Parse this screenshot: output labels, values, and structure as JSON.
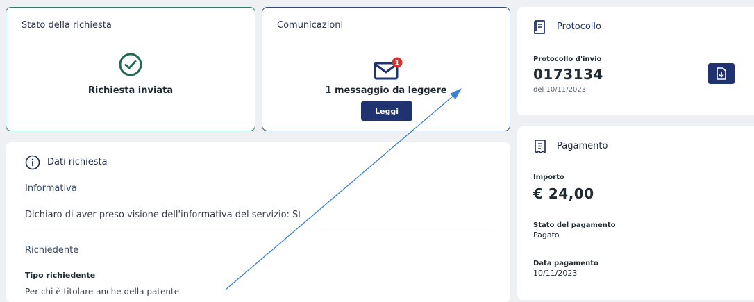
{
  "status": {
    "title": "Stato della richiesta",
    "icon": "check-circle-icon",
    "text": "Richiesta inviata",
    "color": "#1f6b52"
  },
  "communications": {
    "title": "Comunicazioni",
    "icon": "mail-icon",
    "badge": "1",
    "message": "1 messaggio da leggere",
    "button": "Leggi",
    "badge_color": "#d6322a"
  },
  "request_data": {
    "title": "Dati richiesta",
    "icon": "info-icon",
    "sections": [
      {
        "label": "Informativa",
        "text": "Dichiaro di aver preso visione dell'informativa del servizio: Sì"
      },
      {
        "label": "Richiedente",
        "field_label": "Tipo richiedente",
        "field_value": "Per chi è titolare anche della patente"
      }
    ]
  },
  "protocol": {
    "title": "Protocollo",
    "icon": "document-icon",
    "label": "Protocollo d'invio",
    "number": "0173134",
    "date": "del 10/11/2023",
    "download_icon": "download-file-icon"
  },
  "payment": {
    "title": "Pagamento",
    "icon": "receipt-icon",
    "amount_label": "Importo",
    "amount": "€ 24,00",
    "status_label": "Stato del pagamento",
    "status_value": "Pagato",
    "date_label": "Data pagamento",
    "date_value": "10/11/2023"
  },
  "colors": {
    "primary": "#1f3370",
    "success": "#1f6b52",
    "annotation": "#3b82d6"
  }
}
